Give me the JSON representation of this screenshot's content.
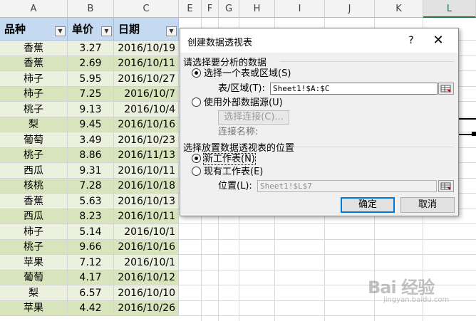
{
  "sheet": {
    "columns": [
      "A",
      "B",
      "C",
      "E",
      "F",
      "G",
      "H",
      "I",
      "J",
      "K",
      "L"
    ],
    "selected_column": "L",
    "headers": [
      "品种",
      "单价",
      "日期"
    ],
    "rows": [
      [
        "香蕉",
        "3.27",
        "2016/10/19"
      ],
      [
        "香蕉",
        "2.69",
        "2016/10/11"
      ],
      [
        "柿子",
        "5.95",
        "2016/10/27"
      ],
      [
        "柿子",
        "7.25",
        "2016/10/7"
      ],
      [
        "桃子",
        "9.13",
        "2016/10/4"
      ],
      [
        "梨",
        "9.45",
        "2016/10/16"
      ],
      [
        "葡萄",
        "3.49",
        "2016/10/23"
      ],
      [
        "桃子",
        "8.86",
        "2016/11/13"
      ],
      [
        "西瓜",
        "9.31",
        "2016/10/11"
      ],
      [
        "核桃",
        "7.28",
        "2016/10/18"
      ],
      [
        "香蕉",
        "5.63",
        "2016/10/13"
      ],
      [
        "西瓜",
        "8.23",
        "2016/10/11"
      ],
      [
        "柿子",
        "5.14",
        "2016/10/1"
      ],
      [
        "桃子",
        "9.66",
        "2016/10/16"
      ],
      [
        "苹果",
        "7.12",
        "2016/10/1"
      ],
      [
        "葡萄",
        "4.17",
        "2016/10/12"
      ],
      [
        "梨",
        "6.57",
        "2016/10/10"
      ],
      [
        "苹果",
        "4.42",
        "2016/10/26"
      ]
    ],
    "band_colors": [
      "#ebf1de",
      "#d8e4bc"
    ],
    "header_color": "#c5d9f1",
    "filter_icon": "dropdown-arrow-icon"
  },
  "dialog": {
    "title": "创建数据透视表",
    "help": "?",
    "close": "✕",
    "section1": "请选择要分析的数据",
    "opt_table": "选择一个表或区域(S)",
    "range_label": "表/区域(T):",
    "range_value": "Sheet1!$A:$C",
    "opt_external": "使用外部数据源(U)",
    "choose_conn": "选择连接(C)...",
    "conn_name": "连接名称:",
    "section2": "选择放置数据透视表的位置",
    "opt_new": "新工作表(N)",
    "opt_existing": "现有工作表(E)",
    "loc_label": "位置(L):",
    "loc_value": "Sheet1!$L$7",
    "ok": "确定",
    "cancel": "取消",
    "accent": "#0078d7"
  },
  "watermark": {
    "text": "Bai 经验",
    "url": "jingyan.baidu.com"
  }
}
